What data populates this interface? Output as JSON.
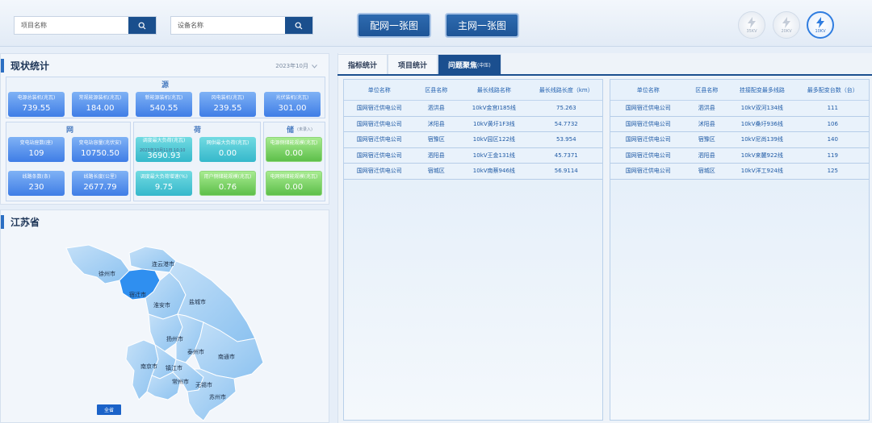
{
  "search": {
    "project_placeholder": "项目名称",
    "device_placeholder": "设备名称"
  },
  "topnav": {
    "dist_net_button": "配网一张图",
    "main_net_button": "主网一张图"
  },
  "voltage_levels": [
    {
      "label": "35KV",
      "active": false
    },
    {
      "label": "20KV",
      "active": false
    },
    {
      "label": "10KV",
      "active": true
    }
  ],
  "status_panel": {
    "title": "现状统计",
    "month": "2023年10月",
    "source": {
      "title": "源",
      "cards": [
        {
          "label": "电源总装机(兆瓦)",
          "value": "739.55"
        },
        {
          "label": "常规能源装机(兆瓦)",
          "value": "184.00"
        },
        {
          "label": "新能源装机(兆瓦)",
          "value": "540.55"
        },
        {
          "label": "风电装机(兆瓦)",
          "value": "239.55"
        },
        {
          "label": "光伏装机(兆瓦)",
          "value": "301.00"
        }
      ]
    },
    "grid": {
      "title": "网",
      "cards": [
        {
          "label": "变电站座数(座)",
          "value": "109"
        },
        {
          "label": "变电站容量(兆伏安)",
          "value": "10750.50"
        },
        {
          "label": "线路条数(条)",
          "value": "230"
        },
        {
          "label": "线路长度(公里)",
          "value": "2677.79"
        }
      ]
    },
    "load": {
      "title": "荷",
      "date": "2023年10月11日 10:10",
      "cards": [
        {
          "label": "调度最大负荷(兆瓦)",
          "value": "3690.93"
        },
        {
          "label": "网供最大负荷(兆瓦)",
          "value": "0.00"
        },
        {
          "label": "调度最大负荷增速(%)",
          "value": "9.75"
        }
      ]
    },
    "storage": {
      "title": "储",
      "note": "(未录入)",
      "cards": [
        {
          "label": "电源侧储能规模(兆瓦)",
          "value": "0.00"
        },
        {
          "label": "用户侧储能规模(兆瓦)",
          "value": "0.76"
        },
        {
          "label": "电网侧储能规模(兆瓦)",
          "value": "0.00"
        }
      ]
    }
  },
  "map_panel": {
    "title": "江苏省",
    "all_button": "全省",
    "cities": [
      "徐州市",
      "连云港市",
      "宿迁市",
      "淮安市",
      "盐城市",
      "扬州市",
      "泰州市",
      "南通市",
      "南京市",
      "镇江市",
      "常州市",
      "无锡市",
      "苏州市"
    ],
    "colors": {
      "selected": "#2f8ff0",
      "region": "#9ccbf3",
      "region_light": "#c4e0f8"
    }
  },
  "tabs": [
    {
      "label": "指标统计",
      "sub": ""
    },
    {
      "label": "项目统计",
      "sub": ""
    },
    {
      "label": "问题聚焦",
      "sub": "(中压)"
    }
  ],
  "table_left": {
    "headers": [
      "单位名称",
      "区县名称",
      "最长线路名称",
      "最长线路长度（km）"
    ],
    "rows": [
      [
        "国网宿迁供电公司",
        "泗洪县",
        "10kV金宫Ⅰ185线",
        "75.263"
      ],
      [
        "国网宿迁供电公司",
        "沭阳县",
        "10kV黄圩1F3线",
        "54.7732"
      ],
      [
        "国网宿迁供电公司",
        "宿豫区",
        "10kV园区122线",
        "53.954"
      ],
      [
        "国网宿迁供电公司",
        "泗阳县",
        "10kV王金131线",
        "45.7371"
      ],
      [
        "国网宿迁供电公司",
        "宿城区",
        "10kV南蔡946线",
        "56.9114"
      ]
    ]
  },
  "table_right": {
    "headers": [
      "单位名称",
      "区县名称",
      "挂接配变最多线路",
      "最多配变台数（台）"
    ],
    "rows": [
      [
        "国网宿迁供电公司",
        "泗洪县",
        "10kV双河134线",
        "111"
      ],
      [
        "国网宿迁供电公司",
        "沭阳县",
        "10kV桑圩936线",
        "106"
      ],
      [
        "国网宿迁供电公司",
        "宿豫区",
        "10kV尼尚139线",
        "140"
      ],
      [
        "国网宿迁供电公司",
        "泗阳县",
        "10kV来麓922线",
        "119"
      ],
      [
        "国网宿迁供电公司",
        "宿城区",
        "10kV洋工924线",
        "125"
      ]
    ]
  }
}
